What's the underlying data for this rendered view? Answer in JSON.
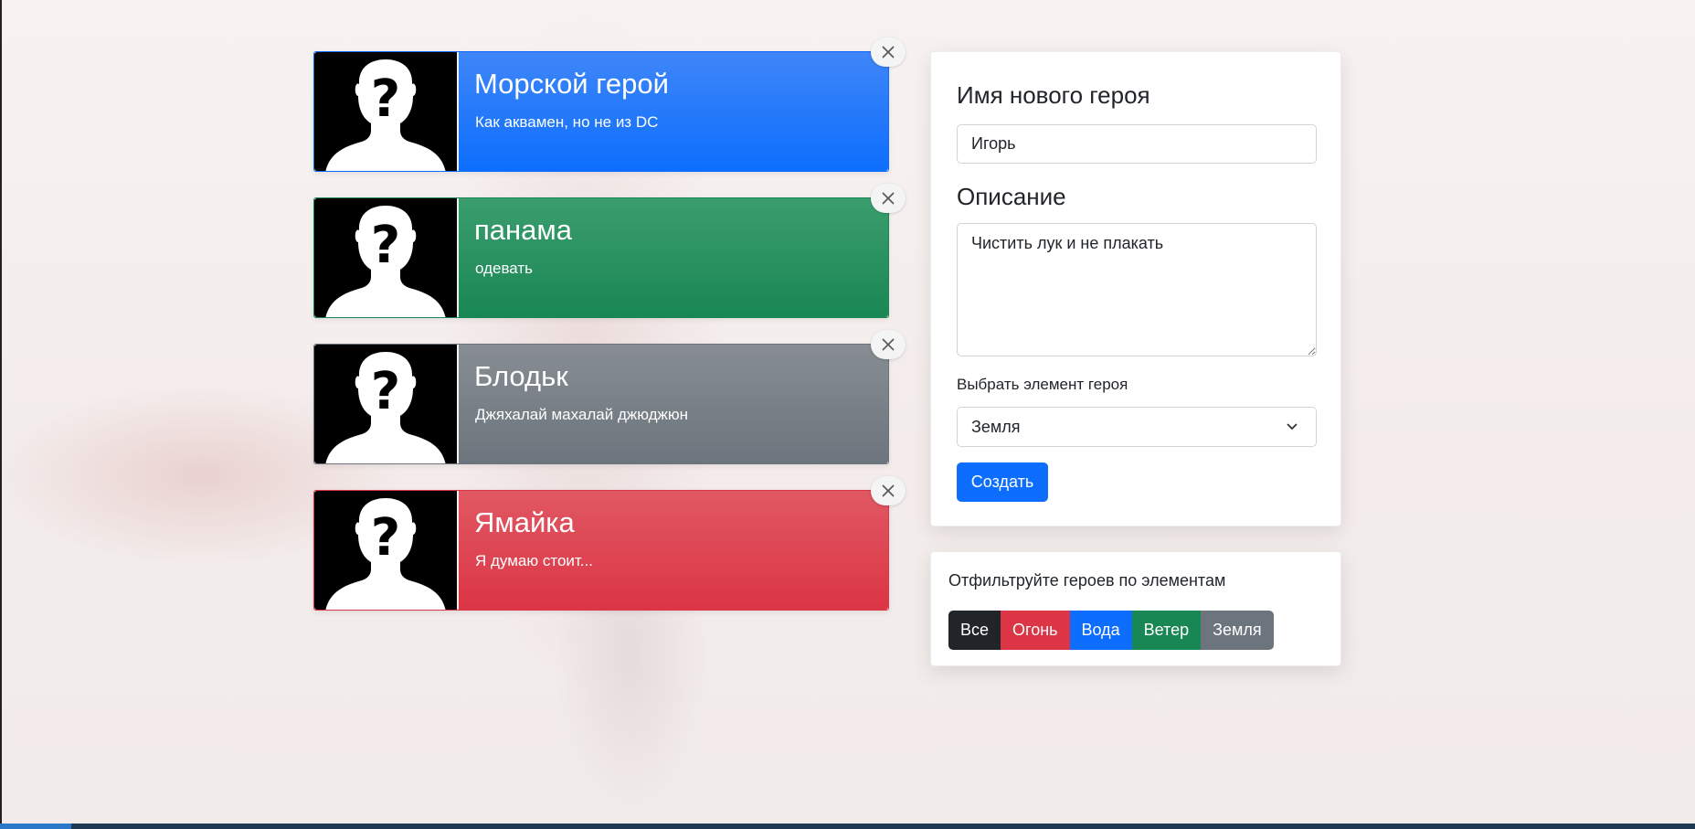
{
  "heroes": [
    {
      "name": "Морской герой",
      "description": "Как аквамен, но не из DC",
      "color": "#0d6efd"
    },
    {
      "name": "панама",
      "description": "одевать",
      "color": "#198754"
    },
    {
      "name": "Блодьк",
      "description": "Джяхалай махалай джюджюн",
      "color": "#6c757d"
    },
    {
      "name": "Ямайка",
      "description": "Я думаю стоит...",
      "color": "#dc3545"
    }
  ],
  "form": {
    "name_label": "Имя нового героя",
    "name_value": "Игорь",
    "description_label": "Описание",
    "description_value": "Чистить лук и не плакать",
    "element_label": "Выбрать элемент героя",
    "element_selected": "Земля",
    "create_label": "Создать"
  },
  "filter": {
    "title": "Отфильтруйте героев по элементам",
    "buttons": [
      {
        "label": "Все",
        "color": "#212529"
      },
      {
        "label": "Огонь",
        "color": "#dc3545"
      },
      {
        "label": "Вода",
        "color": "#0d6efd"
      },
      {
        "label": "Ветер",
        "color": "#198754"
      },
      {
        "label": "Земля",
        "color": "#6c757d"
      }
    ]
  },
  "icons": {
    "avatar": "unknown-person-silhouette-icon",
    "close": "close-icon",
    "select": "chevron-down-icon"
  }
}
